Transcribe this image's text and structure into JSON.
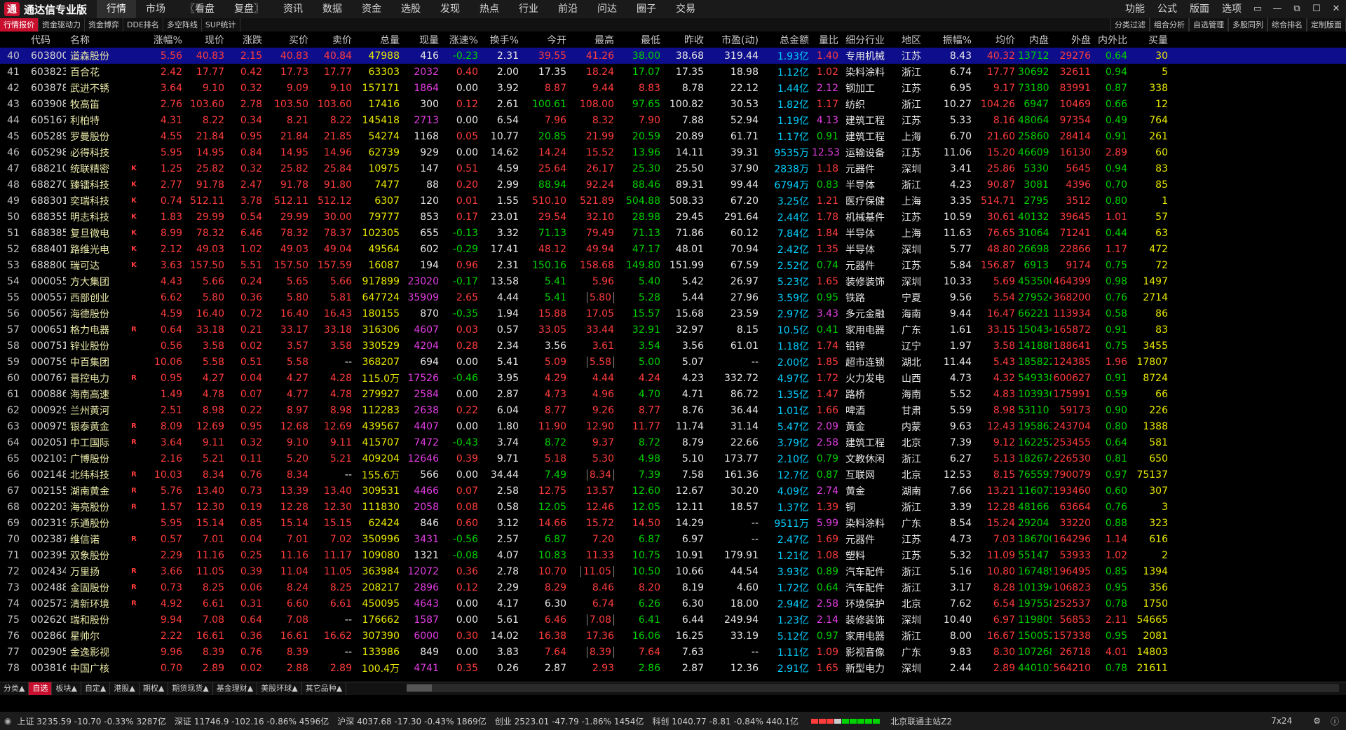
{
  "app": {
    "logo": "通",
    "name": "通达信专业版"
  },
  "topmenu": [
    "行情",
    "市场",
    "〖看盘",
    "复盘〗",
    "资讯",
    "数据",
    "资金",
    "选股",
    "发现",
    "热点",
    "行业",
    "前沿",
    "问达",
    "圈子",
    "交易"
  ],
  "rightmenu": [
    "功能",
    "公式",
    "版面",
    "选项"
  ],
  "winctl": [
    "▭",
    "—",
    "⧉",
    "☐",
    "✕"
  ],
  "subtabs": [
    "行情报价",
    "资金驱动力",
    "资金博弈",
    "DDE排名",
    "多空阵线",
    "SUP统计"
  ],
  "subright": [
    "分类过滤",
    "组合分析",
    "自选管理",
    "多股同列",
    "综合排名",
    "定制版面"
  ],
  "headers": [
    "",
    "代码",
    "名称",
    "",
    "涨幅%",
    "现价",
    "涨跌",
    "买价",
    "卖价",
    "总量",
    "现量",
    "涨速%",
    "换手%",
    "今开",
    "最高",
    "最低",
    "昨收",
    "市盈(动)",
    "总金额",
    "量比",
    "细分行业",
    "地区",
    "振幅%",
    "均价",
    "内盘",
    "外盘",
    "内外比",
    "买量"
  ],
  "rows": [
    [
      "40",
      "603800",
      "道森股份",
      "",
      "5.56",
      "40.83",
      "2.15",
      "40.83",
      "40.84",
      "47988",
      "416",
      "-0.23",
      "2.31",
      "39.55",
      "41.26",
      "38.00",
      "38.68",
      "319.44",
      "1.93亿",
      "1.40",
      "专用机械",
      "江苏",
      "8.43",
      "40.32",
      "13712",
      "29276",
      "0.64",
      "30"
    ],
    [
      "41",
      "603823",
      "百合花",
      "",
      "2.42",
      "17.77",
      "0.42",
      "17.73",
      "17.77",
      "63303",
      "2032",
      "0.40",
      "2.00",
      "17.35",
      "18.24",
      "17.07",
      "17.35",
      "18.98",
      "1.12亿",
      "1.02",
      "染料涂料",
      "浙江",
      "6.74",
      "17.77",
      "30692",
      "32611",
      "0.94",
      "5"
    ],
    [
      "42",
      "603878",
      "武进不锈",
      "",
      "3.64",
      "9.10",
      "0.32",
      "9.09",
      "9.10",
      "157171",
      "1864",
      "0.00",
      "3.92",
      "8.87",
      "9.44",
      "8.83",
      "8.78",
      "22.12",
      "1.44亿",
      "2.12",
      "钢加工",
      "江苏",
      "6.95",
      "9.17",
      "73180",
      "83991",
      "0.87",
      "338"
    ],
    [
      "43",
      "603908",
      "牧高笛",
      "",
      "2.76",
      "103.60",
      "2.78",
      "103.50",
      "103.60",
      "17416",
      "300",
      "0.12",
      "2.61",
      "100.61",
      "108.00",
      "97.65",
      "100.82",
      "30.53",
      "1.82亿",
      "1.17",
      "纺织",
      "浙江",
      "10.27",
      "104.26",
      "6947",
      "10469",
      "0.66",
      "12"
    ],
    [
      "44",
      "605167",
      "利柏特",
      "",
      "4.31",
      "8.22",
      "0.34",
      "8.21",
      "8.22",
      "145418",
      "2713",
      "0.00",
      "6.54",
      "7.96",
      "8.32",
      "7.90",
      "7.88",
      "52.94",
      "1.19亿",
      "4.13",
      "建筑工程",
      "江苏",
      "5.33",
      "8.16",
      "48064",
      "97354",
      "0.49",
      "764"
    ],
    [
      "45",
      "605289",
      "罗曼股份",
      "",
      "4.55",
      "21.84",
      "0.95",
      "21.84",
      "21.85",
      "54274",
      "1168",
      "0.05",
      "10.77",
      "20.85",
      "21.99",
      "20.59",
      "20.89",
      "61.71",
      "1.17亿",
      "0.91",
      "建筑工程",
      "上海",
      "6.70",
      "21.60",
      "25860",
      "28414",
      "0.91",
      "261"
    ],
    [
      "46",
      "605298",
      "必得科技",
      "",
      "5.95",
      "14.95",
      "0.84",
      "14.95",
      "14.96",
      "62739",
      "929",
      "0.00",
      "14.62",
      "14.24",
      "15.52",
      "13.96",
      "14.11",
      "39.31",
      "9535万",
      "12.53",
      "运输设备",
      "江苏",
      "11.06",
      "15.20",
      "46609",
      "16130",
      "2.89",
      "60"
    ],
    [
      "47",
      "688210",
      "统联精密",
      "K",
      "1.25",
      "25.82",
      "0.32",
      "25.82",
      "25.84",
      "10975",
      "147",
      "0.51",
      "4.59",
      "25.64",
      "26.17",
      "25.30",
      "25.50",
      "37.90",
      "2838万",
      "1.18",
      "元器件",
      "深圳",
      "3.41",
      "25.86",
      "5330",
      "5645",
      "0.94",
      "83"
    ],
    [
      "48",
      "688270",
      "臻镭科技",
      "K",
      "2.77",
      "91.78",
      "2.47",
      "91.78",
      "91.80",
      "7477",
      "88",
      "0.20",
      "2.99",
      "88.94",
      "92.24",
      "88.46",
      "89.31",
      "99.44",
      "6794万",
      "0.83",
      "半导体",
      "浙江",
      "4.23",
      "90.87",
      "3081",
      "4396",
      "0.70",
      "85"
    ],
    [
      "49",
      "688301",
      "奕瑞科技",
      "K",
      "0.74",
      "512.11",
      "3.78",
      "512.11",
      "512.12",
      "6307",
      "120",
      "0.01",
      "1.55",
      "510.10",
      "521.89",
      "504.88",
      "508.33",
      "67.20",
      "3.25亿",
      "1.21",
      "医疗保健",
      "上海",
      "3.35",
      "514.71",
      "2795",
      "3512",
      "0.80",
      "1"
    ],
    [
      "50",
      "688355",
      "明志科技",
      "K",
      "1.83",
      "29.99",
      "0.54",
      "29.99",
      "30.00",
      "79777",
      "853",
      "0.17",
      "23.01",
      "29.54",
      "32.10",
      "28.98",
      "29.45",
      "291.64",
      "2.44亿",
      "1.78",
      "机械基件",
      "江苏",
      "10.59",
      "30.61",
      "40132",
      "39645",
      "1.01",
      "57"
    ],
    [
      "51",
      "688385",
      "复旦微电",
      "K",
      "8.99",
      "78.32",
      "6.46",
      "78.32",
      "78.37",
      "102305",
      "655",
      "-0.13",
      "3.32",
      "71.13",
      "79.49",
      "71.13",
      "71.86",
      "60.12",
      "7.84亿",
      "1.84",
      "半导体",
      "上海",
      "11.63",
      "76.65",
      "31064",
      "71241",
      "0.44",
      "63"
    ],
    [
      "52",
      "688401",
      "路维光电",
      "K",
      "2.12",
      "49.03",
      "1.02",
      "49.03",
      "49.04",
      "49564",
      "602",
      "-0.29",
      "17.41",
      "48.12",
      "49.94",
      "47.17",
      "48.01",
      "70.94",
      "2.42亿",
      "1.35",
      "半导体",
      "深圳",
      "5.77",
      "48.80",
      "26698",
      "22866",
      "1.17",
      "472"
    ],
    [
      "53",
      "688800",
      "瑞可达",
      "K",
      "3.63",
      "157.50",
      "5.51",
      "157.50",
      "157.59",
      "16087",
      "194",
      "0.96",
      "2.31",
      "150.16",
      "158.68",
      "149.80",
      "151.99",
      "67.59",
      "2.52亿",
      "0.74",
      "元器件",
      "江苏",
      "5.84",
      "156.87",
      "6913",
      "9174",
      "0.75",
      "72"
    ],
    [
      "54",
      "000055",
      "方大集团",
      "",
      "4.43",
      "5.66",
      "0.24",
      "5.65",
      "5.66",
      "917899",
      "23020",
      "-0.17",
      "13.58",
      "5.41",
      "5.96",
      "5.40",
      "5.42",
      "26.97",
      "5.23亿",
      "1.65",
      "装修装饰",
      "深圳",
      "10.33",
      "5.69",
      "453500",
      "464399",
      "0.98",
      "1497"
    ],
    [
      "55",
      "000557",
      "西部创业",
      "",
      "6.62",
      "5.80",
      "0.36",
      "5.80",
      "5.81",
      "647724",
      "35909",
      "2.65",
      "4.44",
      "5.41",
      "5.80",
      "5.28",
      "5.44",
      "27.96",
      "3.59亿",
      "0.95",
      "铁路",
      "宁夏",
      "9.56",
      "5.54",
      "279524",
      "368200",
      "0.76",
      "2714"
    ],
    [
      "56",
      "000567",
      "海德股份",
      "",
      "4.59",
      "16.40",
      "0.72",
      "16.40",
      "16.43",
      "180155",
      "870",
      "-0.35",
      "1.94",
      "15.88",
      "17.05",
      "15.57",
      "15.68",
      "23.59",
      "2.97亿",
      "3.43",
      "多元金融",
      "海南",
      "9.44",
      "16.47",
      "66221",
      "113934",
      "0.58",
      "86"
    ],
    [
      "57",
      "000651",
      "格力电器",
      "R",
      "0.64",
      "33.18",
      "0.21",
      "33.17",
      "33.18",
      "316306",
      "4607",
      "0.03",
      "0.57",
      "33.05",
      "33.44",
      "32.91",
      "32.97",
      "8.15",
      "10.5亿",
      "0.41",
      "家用电器",
      "广东",
      "1.61",
      "33.15",
      "150434",
      "165872",
      "0.91",
      "83"
    ],
    [
      "58",
      "000751",
      "锌业股份",
      "",
      "0.56",
      "3.58",
      "0.02",
      "3.57",
      "3.58",
      "330529",
      "4204",
      "0.28",
      "2.34",
      "3.56",
      "3.61",
      "3.54",
      "3.56",
      "61.01",
      "1.18亿",
      "1.74",
      "铅锌",
      "辽宁",
      "1.97",
      "3.58",
      "141888",
      "188641",
      "0.75",
      "3455"
    ],
    [
      "59",
      "000759",
      "中百集团",
      "",
      "10.06",
      "5.58",
      "0.51",
      "5.58",
      "--",
      "368207",
      "694",
      "0.00",
      "5.41",
      "5.09",
      "5.58",
      "5.00",
      "5.07",
      "--",
      "2.00亿",
      "1.85",
      "超市连锁",
      "湖北",
      "11.44",
      "5.43",
      "185822",
      "124385",
      "1.96",
      "17807"
    ],
    [
      "60",
      "000767",
      "晋控电力",
      "R",
      "0.95",
      "4.27",
      "0.04",
      "4.27",
      "4.28",
      "115.0万",
      "17526",
      "-0.46",
      "3.95",
      "4.29",
      "4.44",
      "4.24",
      "4.23",
      "332.72",
      "4.97亿",
      "1.72",
      "火力发电",
      "山西",
      "4.73",
      "4.32",
      "549338",
      "600627",
      "0.91",
      "8724"
    ],
    [
      "61",
      "000886",
      "海南高速",
      "",
      "1.49",
      "4.78",
      "0.07",
      "4.77",
      "4.78",
      "279927",
      "2584",
      "0.00",
      "2.87",
      "4.73",
      "4.96",
      "4.70",
      "4.71",
      "86.72",
      "1.35亿",
      "1.47",
      "路桥",
      "海南",
      "5.52",
      "4.83",
      "103936",
      "175991",
      "0.59",
      "66"
    ],
    [
      "62",
      "000929",
      "兰州黄河",
      "",
      "2.51",
      "8.98",
      "0.22",
      "8.97",
      "8.98",
      "112283",
      "2638",
      "0.22",
      "6.04",
      "8.77",
      "9.26",
      "8.77",
      "8.76",
      "36.44",
      "1.01亿",
      "1.66",
      "啤酒",
      "甘肃",
      "5.59",
      "8.98",
      "53110",
      "59173",
      "0.90",
      "226"
    ],
    [
      "63",
      "000975",
      "银泰黄金",
      "R",
      "8.09",
      "12.69",
      "0.95",
      "12.68",
      "12.69",
      "439567",
      "4407",
      "0.00",
      "1.80",
      "11.90",
      "12.90",
      "11.77",
      "11.74",
      "31.14",
      "5.47亿",
      "2.09",
      "黄金",
      "内蒙",
      "9.63",
      "12.43",
      "195863",
      "243704",
      "0.80",
      "1388"
    ],
    [
      "64",
      "002051",
      "中工国际",
      "R",
      "3.64",
      "9.11",
      "0.32",
      "9.10",
      "9.11",
      "415707",
      "7472",
      "-0.43",
      "3.74",
      "8.72",
      "9.37",
      "8.72",
      "8.79",
      "22.66",
      "3.79亿",
      "2.58",
      "建筑工程",
      "北京",
      "7.39",
      "9.12",
      "162252",
      "253455",
      "0.64",
      "581"
    ],
    [
      "65",
      "002103",
      "广博股份",
      "",
      "2.16",
      "5.21",
      "0.11",
      "5.20",
      "5.21",
      "409204",
      "12646",
      "0.39",
      "9.71",
      "5.18",
      "5.30",
      "4.98",
      "5.10",
      "173.77",
      "2.10亿",
      "0.79",
      "文教休闲",
      "浙江",
      "6.27",
      "5.13",
      "182674",
      "226530",
      "0.81",
      "650"
    ],
    [
      "66",
      "002148",
      "北纬科技",
      "R",
      "10.03",
      "8.34",
      "0.76",
      "8.34",
      "--",
      "155.6万",
      "566",
      "0.00",
      "34.44",
      "7.49",
      "8.34",
      "7.39",
      "7.58",
      "161.36",
      "12.7亿",
      "0.87",
      "互联网",
      "北京",
      "12.53",
      "8.15",
      "765593",
      "790079",
      "0.97",
      "75137"
    ],
    [
      "67",
      "002155",
      "湖南黄金",
      "R",
      "5.76",
      "13.40",
      "0.73",
      "13.39",
      "13.40",
      "309531",
      "4466",
      "0.07",
      "2.58",
      "12.75",
      "13.57",
      "12.60",
      "12.67",
      "30.20",
      "4.09亿",
      "2.74",
      "黄金",
      "湖南",
      "7.66",
      "13.21",
      "116071",
      "193460",
      "0.60",
      "307"
    ],
    [
      "68",
      "002203",
      "海亮股份",
      "R",
      "1.57",
      "12.30",
      "0.19",
      "12.28",
      "12.30",
      "111830",
      "2058",
      "0.08",
      "0.58",
      "12.05",
      "12.46",
      "12.05",
      "12.11",
      "18.57",
      "1.37亿",
      "1.39",
      "铜",
      "浙江",
      "3.39",
      "12.28",
      "48166",
      "63664",
      "0.76",
      "3"
    ],
    [
      "69",
      "002319",
      "乐通股份",
      "",
      "5.95",
      "15.14",
      "0.85",
      "15.14",
      "15.15",
      "62424",
      "846",
      "0.60",
      "3.12",
      "14.66",
      "15.72",
      "14.50",
      "14.29",
      "--",
      "9511万",
      "5.99",
      "染料涂料",
      "广东",
      "8.54",
      "15.24",
      "29204",
      "33220",
      "0.88",
      "323"
    ],
    [
      "70",
      "002387",
      "维信诺",
      "R",
      "0.57",
      "7.01",
      "0.04",
      "7.01",
      "7.02",
      "350996",
      "3431",
      "-0.56",
      "2.57",
      "6.87",
      "7.20",
      "6.87",
      "6.97",
      "--",
      "2.47亿",
      "1.69",
      "元器件",
      "江苏",
      "4.73",
      "7.03",
      "186700",
      "164296",
      "1.14",
      "616"
    ],
    [
      "71",
      "002395",
      "双象股份",
      "",
      "2.29",
      "11.16",
      "0.25",
      "11.16",
      "11.17",
      "109080",
      "1321",
      "-0.08",
      "4.07",
      "10.83",
      "11.33",
      "10.75",
      "10.91",
      "179.91",
      "1.21亿",
      "1.08",
      "塑料",
      "江苏",
      "5.32",
      "11.09",
      "55147",
      "53933",
      "1.02",
      "2"
    ],
    [
      "72",
      "002434",
      "万里扬",
      "R",
      "3.66",
      "11.05",
      "0.39",
      "11.04",
      "11.05",
      "363984",
      "12072",
      "0.36",
      "2.78",
      "10.70",
      "11.05",
      "10.50",
      "10.66",
      "44.54",
      "3.93亿",
      "0.89",
      "汽车配件",
      "浙江",
      "5.16",
      "10.80",
      "167489",
      "196495",
      "0.85",
      "1394"
    ],
    [
      "73",
      "002488",
      "金固股份",
      "R",
      "0.73",
      "8.25",
      "0.06",
      "8.24",
      "8.25",
      "208217",
      "2896",
      "0.12",
      "2.29",
      "8.29",
      "8.46",
      "8.20",
      "8.19",
      "4.60",
      "1.72亿",
      "0.64",
      "汽车配件",
      "浙江",
      "3.17",
      "8.28",
      "101394",
      "106823",
      "0.95",
      "356"
    ],
    [
      "74",
      "002573",
      "清新环境",
      "R",
      "4.92",
      "6.61",
      "0.31",
      "6.60",
      "6.61",
      "450095",
      "4643",
      "0.00",
      "4.17",
      "6.30",
      "6.74",
      "6.26",
      "6.30",
      "18.00",
      "2.94亿",
      "2.58",
      "环境保护",
      "北京",
      "7.62",
      "6.54",
      "197558",
      "252537",
      "0.78",
      "1750"
    ],
    [
      "75",
      "002620",
      "瑞和股份",
      "",
      "9.94",
      "7.08",
      "0.64",
      "7.08",
      "--",
      "176662",
      "1587",
      "0.00",
      "5.61",
      "6.46",
      "7.08",
      "6.41",
      "6.44",
      "249.94",
      "1.23亿",
      "2.14",
      "装修装饰",
      "深圳",
      "10.40",
      "6.97",
      "119809",
      "56853",
      "2.11",
      "54665"
    ],
    [
      "76",
      "002860",
      "星帅尔",
      "",
      "2.22",
      "16.61",
      "0.36",
      "16.61",
      "16.62",
      "307390",
      "6000",
      "0.30",
      "14.02",
      "16.38",
      "17.36",
      "16.06",
      "16.25",
      "33.19",
      "5.12亿",
      "0.97",
      "家用电器",
      "浙江",
      "8.00",
      "16.67",
      "150052",
      "157338",
      "0.95",
      "2081"
    ],
    [
      "77",
      "002905",
      "金逸影视",
      "",
      "9.96",
      "8.39",
      "0.76",
      "8.39",
      "--",
      "133986",
      "849",
      "0.00",
      "3.83",
      "7.64",
      "8.39",
      "7.64",
      "7.63",
      "--",
      "1.11亿",
      "1.09",
      "影视音像",
      "广东",
      "9.83",
      "8.30",
      "107268",
      "26718",
      "4.01",
      "14803"
    ],
    [
      "78",
      "003816",
      "中国广核",
      "",
      "0.70",
      "2.89",
      "0.02",
      "2.88",
      "2.89",
      "100.4万",
      "4741",
      "0.35",
      "0.26",
      "2.87",
      "2.93",
      "2.86",
      "2.87",
      "12.36",
      "2.91亿",
      "1.65",
      "新型电力",
      "深圳",
      "2.44",
      "2.89",
      "440103",
      "564210",
      "0.78",
      "21611"
    ]
  ],
  "bottomtabs": [
    "分类▲",
    "自选",
    "板块▲",
    "自定▲",
    "港股▲",
    "期权▲",
    "期货现货▲",
    "基金理财▲",
    "美股环球▲",
    "其它品种▲"
  ],
  "status": {
    "sh": "上证 3235.59 -10.70 -0.33% 3287亿",
    "sz": "深证 11746.9 -102.16 -0.86% 4596亿",
    "hs": "沪深 4037.68 -17.30 -0.43% 1869亿",
    "cy": "创业 2523.01 -47.79 -1.86% 1454亿",
    "kc": "科创 1040.77 -8.81 -0.84% 440.1亿",
    "server": "北京联通主站Z2",
    "time": "7x24"
  },
  "colors": {
    "up": "#ff3c3c",
    "down": "#00d200",
    "selected_row": "#0e0e8c",
    "accent": "#c8102e"
  }
}
